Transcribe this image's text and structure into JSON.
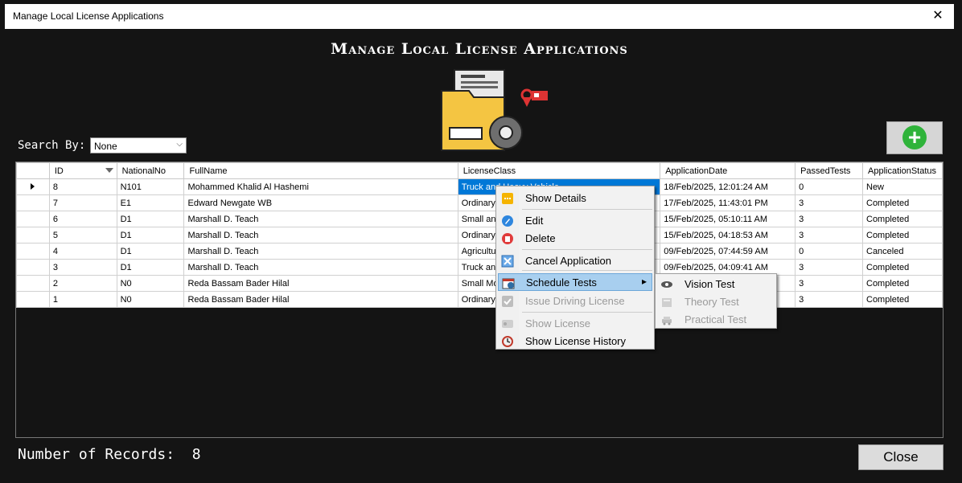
{
  "window": {
    "title": "Manage Local License Applications",
    "close_glyph": "✕"
  },
  "heading": "Manage Local License Applications",
  "search": {
    "label": "Search By:",
    "selected": "None"
  },
  "table": {
    "columns": [
      "",
      "ID",
      "NationalNo",
      "FullName",
      "LicenseClass",
      "ApplicationDate",
      "PassedTests",
      "ApplicationStatus"
    ],
    "rows": [
      {
        "id": "8",
        "nationalNo": "N101",
        "fullName": "Mohammed Khalid Al Hashemi",
        "licenseClass": "Truck and Heavy Vehicle",
        "applicationDate": "18/Feb/2025, 12:01:24 AM",
        "passedTests": "0",
        "status": "New"
      },
      {
        "id": "7",
        "nationalNo": "E1",
        "fullName": "Edward  Newgate WB",
        "licenseClass": "Ordinary l",
        "applicationDate": "17/Feb/2025, 11:43:01 PM",
        "passedTests": "3",
        "status": "Completed"
      },
      {
        "id": "6",
        "nationalNo": "D1",
        "fullName": "Marshall D. Teach",
        "licenseClass": "Small and",
        "applicationDate": "15/Feb/2025, 05:10:11 AM",
        "passedTests": "3",
        "status": "Completed"
      },
      {
        "id": "5",
        "nationalNo": "D1",
        "fullName": "Marshall D. Teach",
        "licenseClass": "Ordinary l",
        "applicationDate": "15/Feb/2025, 04:18:53 AM",
        "passedTests": "3",
        "status": "Completed"
      },
      {
        "id": "4",
        "nationalNo": "D1",
        "fullName": "Marshall D. Teach",
        "licenseClass": "Agricultur",
        "applicationDate": "09/Feb/2025, 07:44:59 AM",
        "passedTests": "0",
        "status": "Canceled"
      },
      {
        "id": "3",
        "nationalNo": "D1",
        "fullName": "Marshall D. Teach",
        "licenseClass": "Truck and",
        "applicationDate": "09/Feb/2025, 04:09:41 AM",
        "passedTests": "3",
        "status": "Completed"
      },
      {
        "id": "2",
        "nationalNo": "N0",
        "fullName": "Reda Bassam Bader Hilal",
        "licenseClass": "Small Mot",
        "applicationDate": "",
        "passedTests": "3",
        "status": "Completed"
      },
      {
        "id": "1",
        "nationalNo": "N0",
        "fullName": "Reda Bassam Bader Hilal",
        "licenseClass": "Ordinary l",
        "applicationDate": "",
        "passedTests": "3",
        "status": "Completed"
      }
    ]
  },
  "context_menu": {
    "items": [
      {
        "label": "Show Details",
        "icon": "details-icon",
        "disabled": false
      },
      {
        "label": "Edit",
        "icon": "edit-icon",
        "disabled": false
      },
      {
        "label": "Delete",
        "icon": "delete-icon",
        "disabled": false
      },
      {
        "label": "Cancel Application",
        "icon": "cancel-icon",
        "disabled": false
      },
      {
        "label": "Schedule Tests",
        "icon": "calendar-icon",
        "disabled": false
      },
      {
        "label": "Issue Driving License",
        "icon": "check-icon",
        "disabled": true
      },
      {
        "label": "Show License",
        "icon": "license-icon",
        "disabled": true
      },
      {
        "label": "Show License History",
        "icon": "history-icon",
        "disabled": false
      }
    ],
    "submenu_arrow": "▸"
  },
  "submenu": {
    "items": [
      {
        "label": "Vision Test",
        "icon": "eye-icon",
        "disabled": false
      },
      {
        "label": "Theory Test",
        "icon": "theory-icon",
        "disabled": true
      },
      {
        "label": "Practical Test",
        "icon": "car-icon",
        "disabled": true
      }
    ]
  },
  "footer": {
    "records_label": "Number of Records:",
    "records_count": "8",
    "close_label": "Close"
  },
  "colors": {
    "selection": "#0078d7",
    "highlight": "#a8cfef",
    "add_green": "#2fb33a"
  }
}
